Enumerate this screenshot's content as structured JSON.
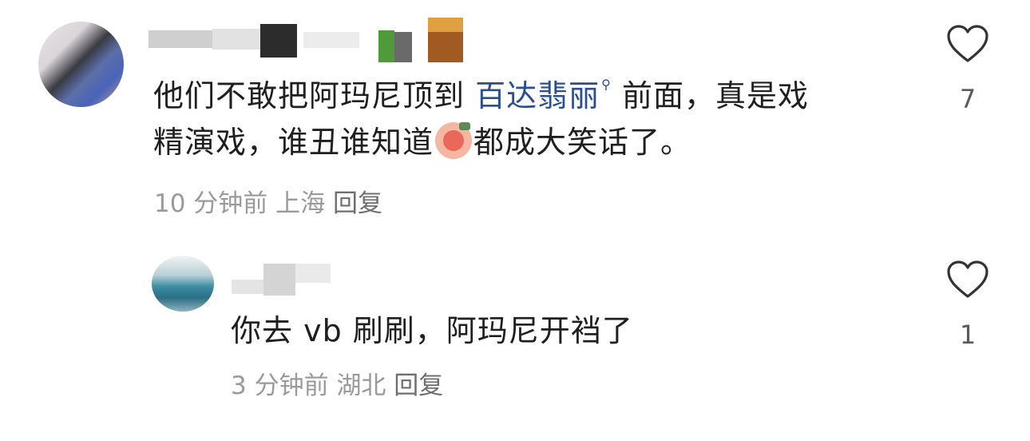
{
  "comment": {
    "text_before_topic": "他们不敢把阿玛尼顶到",
    "topic": "百达翡丽",
    "text_after_topic_line1": "前面，真是戏",
    "text_line2_before_emoji": "精演戏，谁丑谁知道",
    "text_line2_after_emoji": "都成大笑话了。",
    "time": "10 分钟前",
    "location": "上海",
    "reply_label": "回复",
    "like_count": "7"
  },
  "reply": {
    "text": "你去 vb 刷刷，阿玛尼开裆了",
    "time": "3 分钟前",
    "location": "湖北",
    "reply_label": "回复",
    "like_count": "1"
  },
  "icons": {
    "like": "heart-outline-icon",
    "topic_search": "search-icon",
    "emoji": "laugh-cry-emoji-icon"
  },
  "colors": {
    "topic_link": "#2a4f8d",
    "meta_text": "#9a9a9a",
    "reply_link": "#6f6f6f"
  }
}
